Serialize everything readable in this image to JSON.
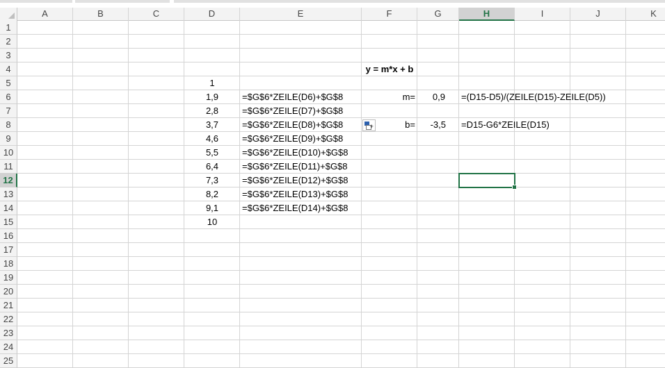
{
  "columns": [
    "A",
    "B",
    "C",
    "D",
    "E",
    "F",
    "G",
    "H",
    "I",
    "J",
    "K"
  ],
  "selected_column": "H",
  "rows": [
    "1",
    "2",
    "3",
    "4",
    "5",
    "6",
    "7",
    "8",
    "9",
    "10",
    "11",
    "12",
    "13",
    "14",
    "15",
    "16",
    "17",
    "18",
    "19",
    "20",
    "21",
    "22",
    "23",
    "24",
    "25"
  ],
  "selected_row": "12",
  "cells": {
    "F4": "y = m*x + b",
    "D5": "1",
    "D6": "1,9",
    "E6": "=$G$6*ZEILE(D6)+$G$8",
    "D7": "2,8",
    "E7": "=$G$6*ZEILE(D7)+$G$8",
    "D8": "3,7",
    "E8": "=$G$6*ZEILE(D8)+$G$8",
    "D9": "4,6",
    "E9": "=$G$6*ZEILE(D9)+$G$8",
    "D10": "5,5",
    "E10": "=$G$6*ZEILE(D10)+$G$8",
    "D11": "6,4",
    "E11": "=$G$6*ZEILE(D11)+$G$8",
    "D12": "7,3",
    "E12": "=$G$6*ZEILE(D12)+$G$8",
    "D13": "8,2",
    "E13": "=$G$6*ZEILE(D13)+$G$8",
    "D14": "9,1",
    "E14": "=$G$6*ZEILE(D14)+$G$8",
    "D15": "10",
    "F6": "m=",
    "G6": "0,9",
    "H6": "=(D15-D5)/(ZEILE(D15)-ZEILE(D5))",
    "F8": "b=",
    "G8": "-3,5",
    "H8": "=D15-G6*ZEILE(D15)"
  },
  "active_cell": "H12",
  "paste_options_icon": "paste-options-icon",
  "colors": {
    "accent": "#217346",
    "header_bg": "#f3f3f3",
    "gridline": "#d4d4d4"
  }
}
